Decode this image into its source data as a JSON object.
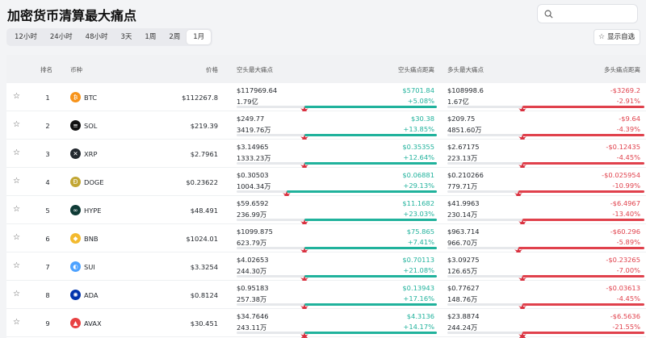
{
  "title": "加密货币清算最大痛点",
  "search": {
    "placeholder": ""
  },
  "tabs": [
    {
      "label": "12小时",
      "active": false
    },
    {
      "label": "24小时",
      "active": false
    },
    {
      "label": "48小时",
      "active": false
    },
    {
      "label": "3天",
      "active": false
    },
    {
      "label": "1周",
      "active": false
    },
    {
      "label": "2周",
      "active": false
    },
    {
      "label": "1月",
      "active": true
    }
  ],
  "watchlist_button": "显示自选",
  "columns": {
    "rank": "排名",
    "coin": "币种",
    "price": "价格",
    "short_pain": "空头最大痛点",
    "short_distance": "空头痛点距离",
    "long_pain": "多头最大痛点",
    "long_distance": "多头痛点距离"
  },
  "colors": {
    "short": "#20b29c",
    "long": "#e0414c",
    "burst": "#d9303f"
  },
  "rows": [
    {
      "rank": "1",
      "coin": "BTC",
      "icon": "btc-icon",
      "icon_color": "#f7931a",
      "icon_glyph": "₿",
      "price": "$112267.8",
      "short_price": "$117969.64",
      "short_amount": "1.79亿",
      "short_dist": "$5701.84",
      "short_pct": "+5.08%",
      "short_bar": 0.66,
      "long_price": "$108998.6",
      "long_amount": "1.67亿",
      "long_dist": "-$3269.2",
      "long_pct": "-2.91%",
      "long_bar": 0.62
    },
    {
      "rank": "2",
      "coin": "SOL",
      "icon": "sol-icon",
      "icon_color": "#111111",
      "icon_glyph": "≡",
      "price": "$219.39",
      "short_price": "$249.77",
      "short_amount": "3419.76万",
      "short_dist": "$30.38",
      "short_pct": "+13.85%",
      "short_bar": 0.66,
      "long_price": "$209.75",
      "long_amount": "4851.60万",
      "long_dist": "-$9.64",
      "long_pct": "-4.39%",
      "long_bar": 0.62
    },
    {
      "rank": "3",
      "coin": "XRP",
      "icon": "xrp-icon",
      "icon_color": "#23292f",
      "icon_glyph": "✕",
      "price": "$2.7961",
      "short_price": "$3.14965",
      "short_amount": "1333.23万",
      "short_dist": "$0.35355",
      "short_pct": "+12.64%",
      "short_bar": 0.66,
      "long_price": "$2.67175",
      "long_amount": "223.13万",
      "long_dist": "-$0.12435",
      "long_pct": "-4.45%",
      "long_bar": 0.62
    },
    {
      "rank": "4",
      "coin": "DOGE",
      "icon": "doge-icon",
      "icon_color": "#c2a633",
      "icon_glyph": "Ð",
      "price": "$0.23622",
      "short_price": "$0.30503",
      "short_amount": "1004.34万",
      "short_dist": "$0.06881",
      "short_pct": "+29.13%",
      "short_bar": 0.75,
      "long_price": "$0.210266",
      "long_amount": "779.71万",
      "long_dist": "-$0.025954",
      "long_pct": "-10.99%",
      "long_bar": 0.64
    },
    {
      "rank": "5",
      "coin": "HYPE",
      "icon": "hype-icon",
      "icon_color": "#0f3b36",
      "icon_glyph": "∞",
      "price": "$48.491",
      "short_price": "$59.6592",
      "short_amount": "236.99万",
      "short_dist": "$11.1682",
      "short_pct": "+23.03%",
      "short_bar": 0.66,
      "long_price": "$41.9963",
      "long_amount": "230.14万",
      "long_dist": "-$6.4967",
      "long_pct": "-13.40%",
      "long_bar": 0.62
    },
    {
      "rank": "6",
      "coin": "BNB",
      "icon": "bnb-icon",
      "icon_color": "#f3ba2f",
      "icon_glyph": "◆",
      "price": "$1024.01",
      "short_price": "$1099.875",
      "short_amount": "623.79万",
      "short_dist": "$75.865",
      "short_pct": "+7.41%",
      "short_bar": 0.66,
      "long_price": "$963.714",
      "long_amount": "966.70万",
      "long_dist": "-$60.296",
      "long_pct": "-5.89%",
      "long_bar": 0.64
    },
    {
      "rank": "7",
      "coin": "SUI",
      "icon": "sui-icon",
      "icon_color": "#4da2ff",
      "icon_glyph": "◐",
      "price": "$3.3254",
      "short_price": "$4.02653",
      "short_amount": "244.30万",
      "short_dist": "$0.70113",
      "short_pct": "+21.08%",
      "short_bar": 0.66,
      "long_price": "$3.09275",
      "long_amount": "126.65万",
      "long_dist": "-$0.23265",
      "long_pct": "-7.00%",
      "long_bar": 0.62
    },
    {
      "rank": "8",
      "coin": "ADA",
      "icon": "ada-icon",
      "icon_color": "#0033ad",
      "icon_glyph": "✺",
      "price": "$0.8124",
      "short_price": "$0.95183",
      "short_amount": "257.38万",
      "short_dist": "$0.13943",
      "short_pct": "+17.16%",
      "short_bar": 0.66,
      "long_price": "$0.77627",
      "long_amount": "148.76万",
      "long_dist": "-$0.03613",
      "long_pct": "-4.45%",
      "long_bar": 0.62
    },
    {
      "rank": "9",
      "coin": "AVAX",
      "icon": "avax-icon",
      "icon_color": "#e84142",
      "icon_glyph": "▲",
      "price": "$30.451",
      "short_price": "$34.7646",
      "short_amount": "243.11万",
      "short_dist": "$4.3136",
      "short_pct": "+14.17%",
      "short_bar": 0.66,
      "long_price": "$23.8874",
      "long_amount": "244.24万",
      "long_dist": "-$6.5636",
      "long_pct": "-21.55%",
      "long_bar": 0.62
    }
  ]
}
